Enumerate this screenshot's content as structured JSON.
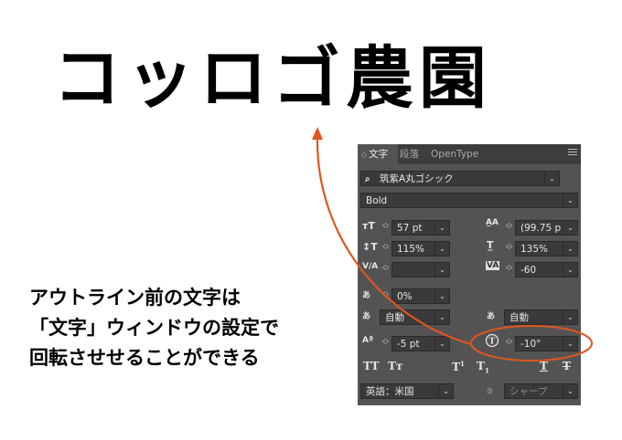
{
  "headline": "コッロゴ農園",
  "caption": {
    "line1": "アウトライン前の文字は",
    "line2": "「文字」ウィンドウの設定で",
    "line3": "回転させせることができる"
  },
  "panel": {
    "tabs": [
      {
        "label": "文字",
        "active": true
      },
      {
        "label": "段落",
        "active": false
      },
      {
        "label": "OpenType",
        "active": false
      }
    ],
    "font_family": "筑紫A丸ゴシック",
    "font_style": "Bold",
    "font_size": "57 pt",
    "leading": "(99.75 p",
    "vertical_scale": "115%",
    "horizontal_scale": "135%",
    "kerning": "",
    "tracking": "-60",
    "tsume": "0%",
    "aki_left": "自動",
    "aki_right": "自動",
    "baseline_shift": "-5 pt",
    "char_rotation": "-10°",
    "language": "英語：米国",
    "antialias_icon_label": "a",
    "antialias": "シャープ"
  },
  "colors": {
    "panel_bg": "#535353",
    "field_bg": "#3a3a3a",
    "highlight": "#e0561e"
  }
}
